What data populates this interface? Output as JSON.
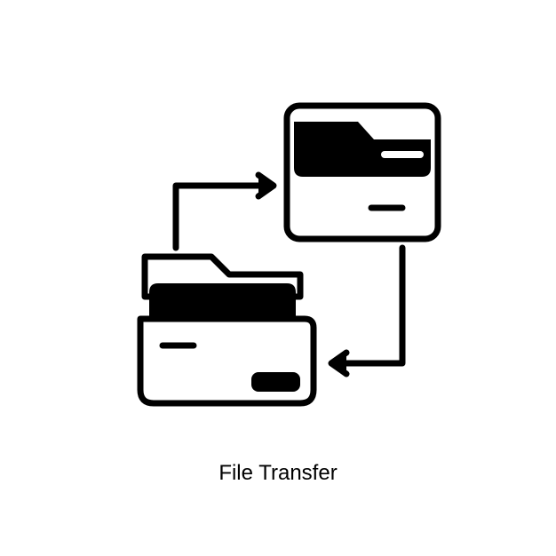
{
  "caption": "File Transfer",
  "icon_name": "file-transfer-icon",
  "stroke_color": "#000000",
  "fill_color": "#000000"
}
